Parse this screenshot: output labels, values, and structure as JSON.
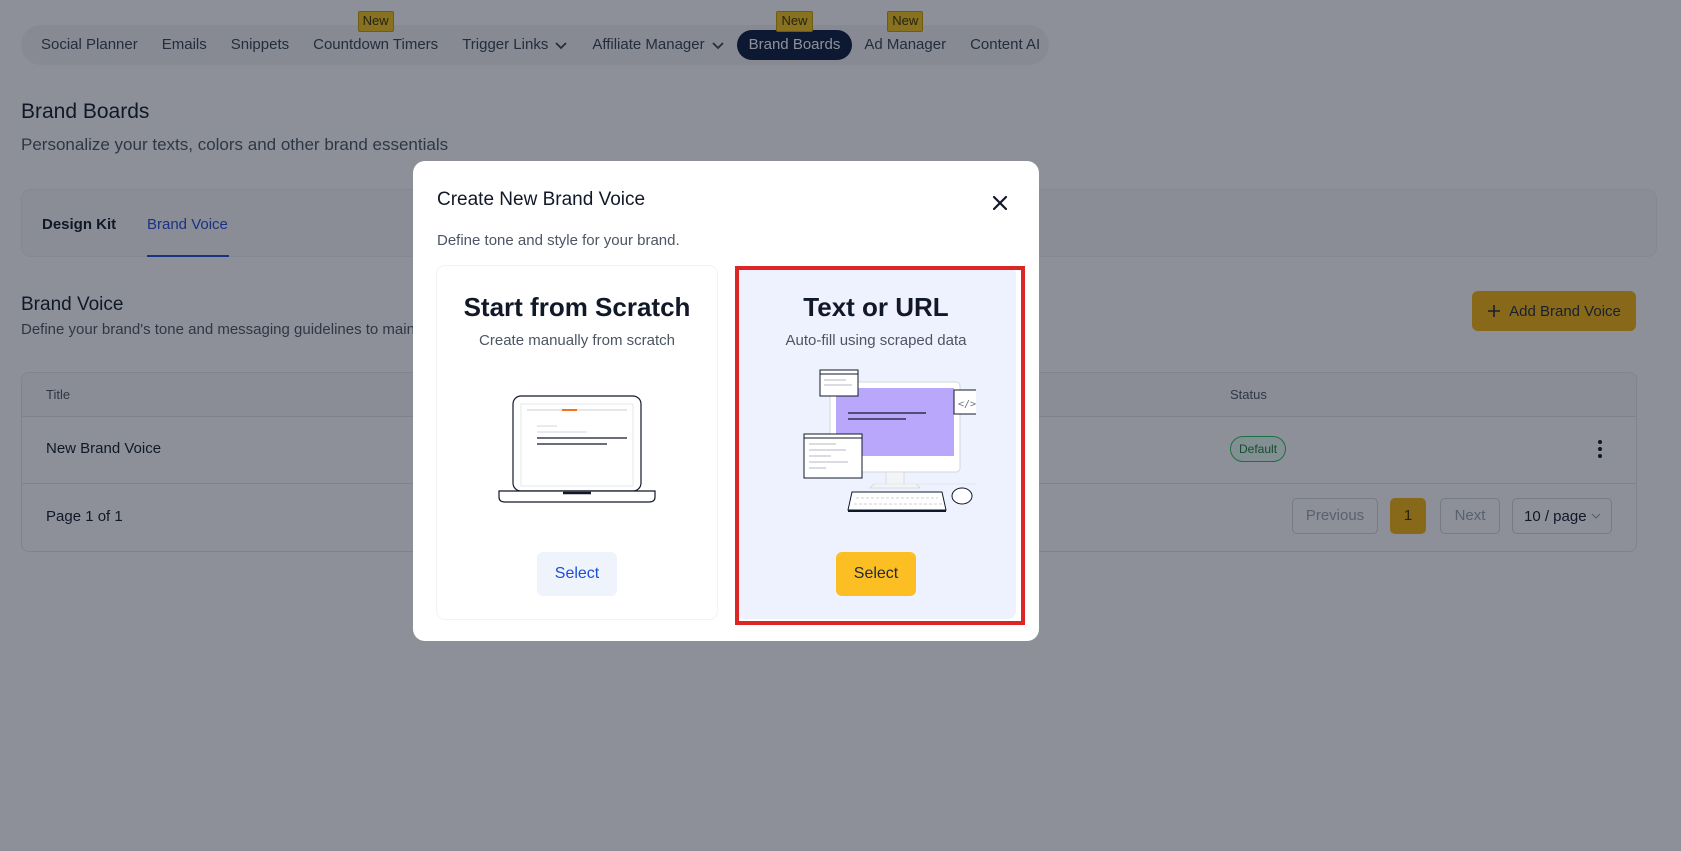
{
  "nav": {
    "items": [
      {
        "label": "Social Planner",
        "badge": ""
      },
      {
        "label": "Emails",
        "badge": ""
      },
      {
        "label": "Snippets",
        "badge": ""
      },
      {
        "label": "Countdown Timers",
        "badge": "New"
      },
      {
        "label": "Trigger Links",
        "badge": ""
      },
      {
        "label": "Affiliate Manager",
        "badge": ""
      },
      {
        "label": "Brand Boards",
        "badge": "New"
      },
      {
        "label": "Ad Manager",
        "badge": "New"
      },
      {
        "label": "Content AI",
        "badge": ""
      }
    ]
  },
  "page": {
    "title": "Brand Boards",
    "subtitle": "Personalize your texts, colors and other brand essentials"
  },
  "tabs": [
    "Design Kit",
    "Brand Voice"
  ],
  "section": {
    "title": "Brand Voice",
    "description": "Define your brand's tone and messaging guidelines to main",
    "add_button": "Add Brand Voice"
  },
  "table": {
    "headers": {
      "title": "Title",
      "status": "Status"
    },
    "rows": [
      {
        "title": "New Brand Voice",
        "status": "Default"
      }
    ],
    "footer": {
      "page_info": "Page 1 of 1",
      "previous": "Previous",
      "current": "1",
      "next": "Next",
      "per_page": "10 / page"
    }
  },
  "modal": {
    "title": "Create New Brand Voice",
    "description": "Define tone and style for your brand.",
    "options": [
      {
        "title": "Start from Scratch",
        "subtitle": "Create manually from scratch",
        "select": "Select"
      },
      {
        "title": "Text or URL",
        "subtitle": "Auto-fill using scraped data",
        "select": "Select"
      }
    ]
  },
  "colors": {
    "accent": "#f5b50d",
    "nav_active": "#0b1b3f",
    "link": "#1d4ed8",
    "highlight": "#dc2626"
  }
}
